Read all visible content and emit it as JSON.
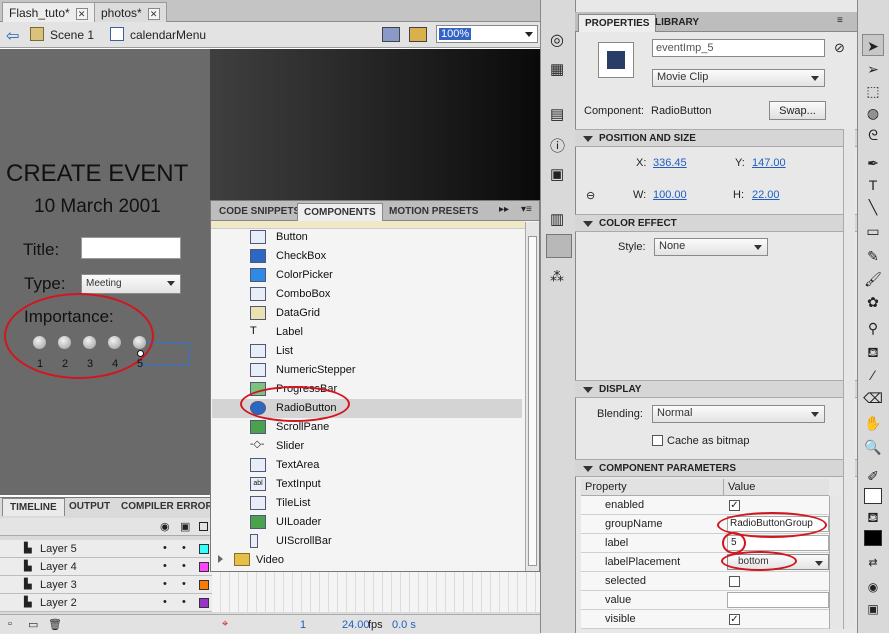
{
  "doc_tabs": [
    {
      "label": "Flash_tuto*"
    },
    {
      "label": "photos*"
    }
  ],
  "editbar": {
    "scene": "Scene 1",
    "symbol": "calendarMenu",
    "zoom": "100%"
  },
  "stage": {
    "heading": "CREATE EVENT",
    "date": "10  March 2001",
    "title_label": "Title:",
    "type_label": "Type:",
    "type_value": "Meeting",
    "importance_label": "Importance:",
    "radio_labels": [
      "1",
      "2",
      "3",
      "4",
      "5"
    ]
  },
  "components": {
    "tabs": [
      "CODE SNIPPETS",
      "COMPONENTS",
      "MOTION PRESETS"
    ],
    "items": [
      "Button",
      "CheckBox",
      "ColorPicker",
      "ComboBox",
      "DataGrid",
      "Label",
      "List",
      "NumericStepper",
      "ProgressBar",
      "RadioButton",
      "ScrollPane",
      "Slider",
      "TextArea",
      "TextInput",
      "TileList",
      "UILoader",
      "UIScrollBar"
    ],
    "folder": "Video",
    "selected": "RadioButton"
  },
  "timeline": {
    "tabs": [
      "TIMELINE",
      "OUTPUT",
      "COMPILER ERROR"
    ],
    "layers": [
      "Layer 5",
      "Layer 4",
      "Layer 3",
      "Layer 2"
    ],
    "layer_colors": [
      "#33ffff",
      "#ff44ff",
      "#ff7a00",
      "#9933cc"
    ],
    "frame": "1",
    "fps": "24.00",
    "fps_unit": "fps",
    "time": "0.0 s"
  },
  "properties": {
    "tabs": [
      "PROPERTIES",
      "LIBRARY"
    ],
    "instance_name": "eventImp_5",
    "symbol_type": "Movie Clip",
    "component_label": "Component:",
    "component_name": "RadioButton",
    "swap_label": "Swap...",
    "pos_section": "POSITION AND SIZE",
    "x_label": "X:",
    "x": "336.45",
    "y_label": "Y:",
    "y": "147.00",
    "w_label": "W:",
    "w": "100.00",
    "h_label": "H:",
    "h": "22.00",
    "color_section": "COLOR EFFECT",
    "style_label": "Style:",
    "style": "None",
    "display_section": "DISPLAY",
    "blending_label": "Blending:",
    "blending": "Normal",
    "cache_label": "Cache as bitmap",
    "params_section": "COMPONENT PARAMETERS",
    "param_header_prop": "Property",
    "param_header_val": "Value",
    "params": [
      {
        "prop": "enabled",
        "value": "",
        "checked": true
      },
      {
        "prop": "groupName",
        "value": "RadioButtonGroup"
      },
      {
        "prop": "label",
        "value": "5"
      },
      {
        "prop": "labelPlacement",
        "value": "bottom"
      },
      {
        "prop": "selected",
        "value": "",
        "checked": false
      },
      {
        "prop": "value",
        "value": ""
      },
      {
        "prop": "visible",
        "value": "",
        "checked": true
      }
    ]
  },
  "accent_red": "#d2161e"
}
